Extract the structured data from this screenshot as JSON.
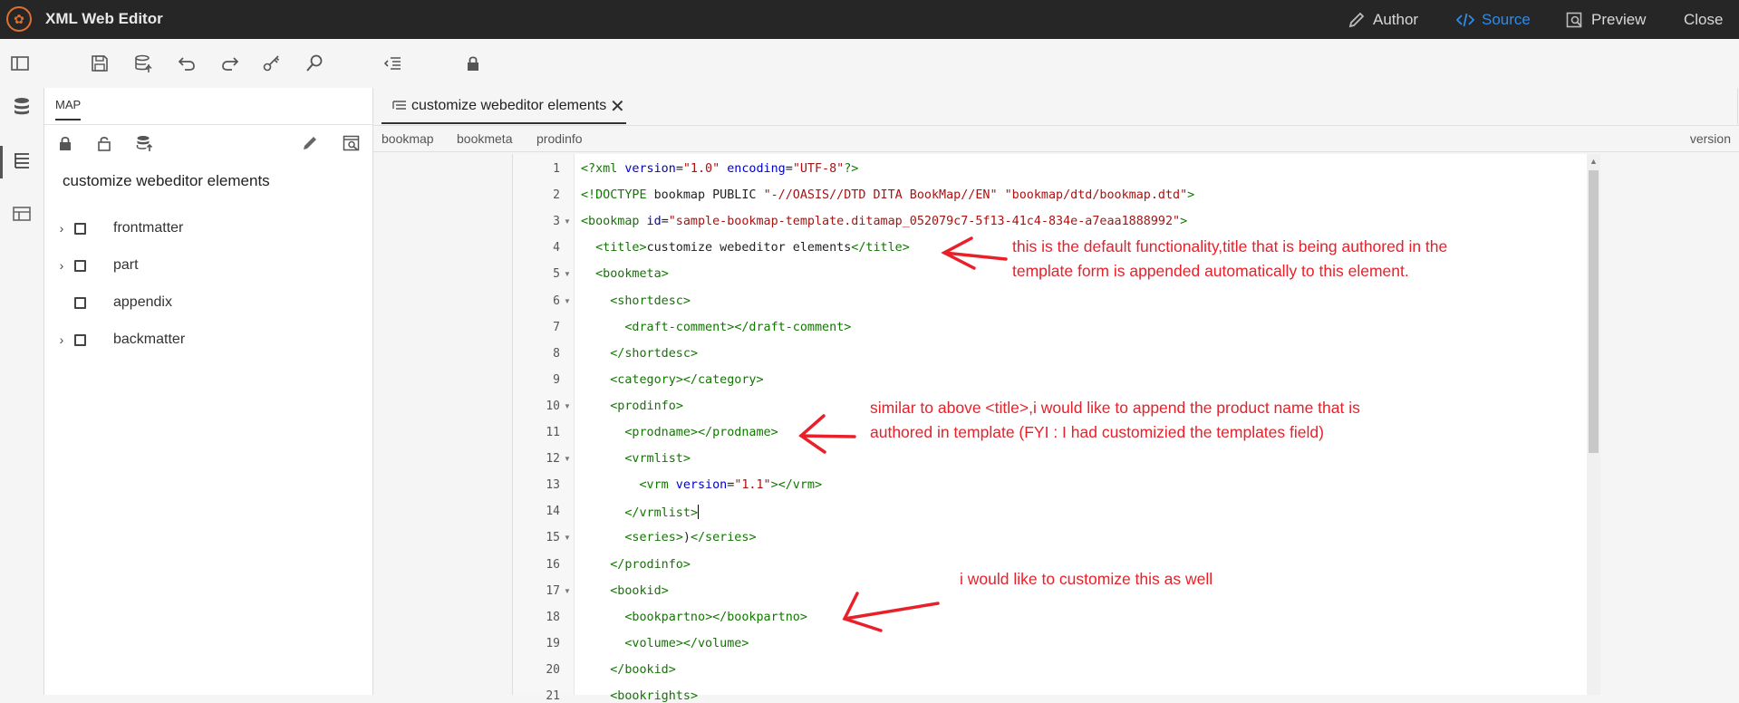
{
  "app": {
    "title": "XML Web Editor",
    "logo_icon": "app-logo-icon"
  },
  "topnav": {
    "author": "Author",
    "source": "Source",
    "preview": "Preview",
    "close": "Close"
  },
  "colors": {
    "titlebar": "#262626",
    "source_active": "#2d8ceb",
    "xml_tag": "#117700",
    "xml_attr": "#0000cc",
    "xml_value": "#aa1111",
    "annotation": "#e8202a"
  },
  "map": {
    "tab": "MAP",
    "title": "customize webeditor elements",
    "items": [
      {
        "label": "frontmatter",
        "expandable": true
      },
      {
        "label": "part",
        "expandable": true
      },
      {
        "label": "appendix",
        "expandable": false
      },
      {
        "label": "backmatter",
        "expandable": true
      }
    ]
  },
  "editor": {
    "tab_label": "customize webeditor elements",
    "breadcrumbs": [
      "bookmap",
      "bookmeta",
      "prodinfo"
    ],
    "breadcrumb_right": "version",
    "line_numbers": [
      "1",
      "2",
      "3",
      "4",
      "5",
      "6",
      "7",
      "8",
      "9",
      "10",
      "11",
      "12",
      "13",
      "14",
      "15",
      "16",
      "17",
      "18",
      "19",
      "20",
      "21"
    ],
    "lines": [
      "<?xml version=\"1.0\" encoding=\"UTF-8\"?>",
      "<!DOCTYPE bookmap PUBLIC \"-//OASIS//DTD DITA BookMap//EN\" \"bookmap/dtd/bookmap.dtd\">",
      "<bookmap id=\"sample-bookmap-template.ditamap_052079c7-5f13-41c4-834e-a7eaa1888992\">",
      "  <title>customize webeditor elements</title>",
      "  <bookmeta>",
      "    <shortdesc>",
      "      <draft-comment></draft-comment>",
      "    </shortdesc>",
      "    <category></category>",
      "    <prodinfo>",
      "      <prodname></prodname>",
      "      <vrmlist>",
      "        <vrm version=\"1.1\"></vrm>",
      "      </vrmlist>",
      "      <series>)</series>",
      "    </prodinfo>",
      "    <bookid>",
      "      <bookpartno></bookpartno>",
      "      <volume></volume>",
      "    </bookid>",
      "    <bookrights>"
    ]
  },
  "annotations": {
    "note1_line1": "this is the default functionality,title that is being authored in the",
    "note1_line2": "template form is appended automatically to this element.",
    "note2_line1": "similar to above <title>,i would like to append the product name that is",
    "note2_line2": "authored in template (FYI : I had customizied the templates field)",
    "note3": "i would like to customize this as well"
  }
}
